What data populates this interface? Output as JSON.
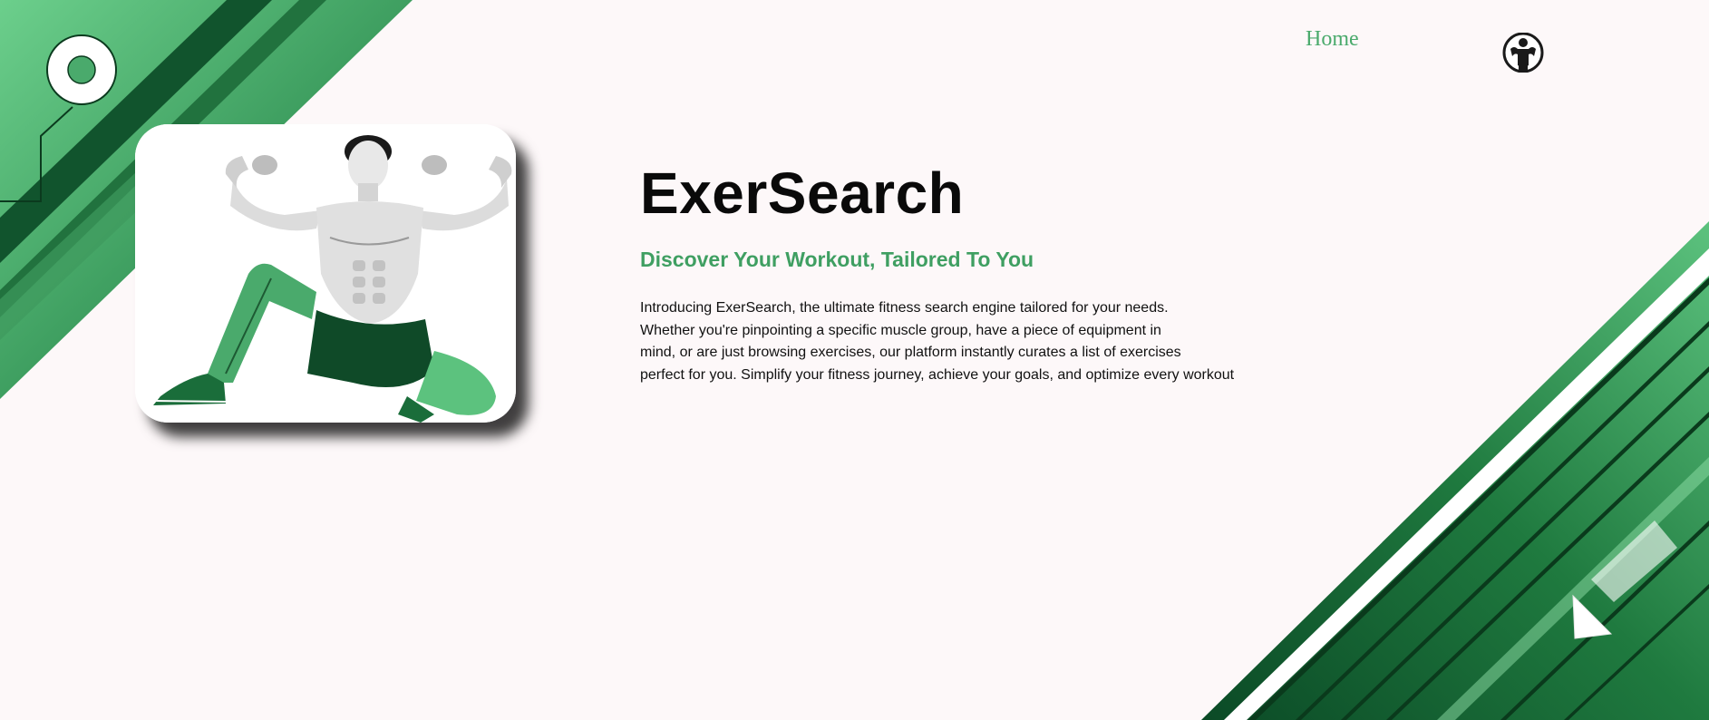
{
  "nav": {
    "home_label": "Home",
    "logo_icon": "bodybuilder-logo-icon"
  },
  "hero": {
    "image_alt": "Muscular man flexing in green leggings",
    "title": "ExerSearch",
    "subtitle": "Discover Your Workout, Tailored To You",
    "intro": "Introducing ExerSearch, the ultimate fitness search engine tailored for your needs.\nWhether you're pinpointing a specific muscle group, have a piece of equipment in\nmind, or are just browsing exercises, our platform instantly curates a list of exercises\nperfect for you. Simplify your fitness journey, achieve your goals, and optimize every workout"
  },
  "colors": {
    "accent": "#4aaa6c",
    "dark_green": "#0b4a26",
    "mid_green": "#2e8b50",
    "light_green": "#6ccf8c",
    "background": "#fdf8f9"
  }
}
